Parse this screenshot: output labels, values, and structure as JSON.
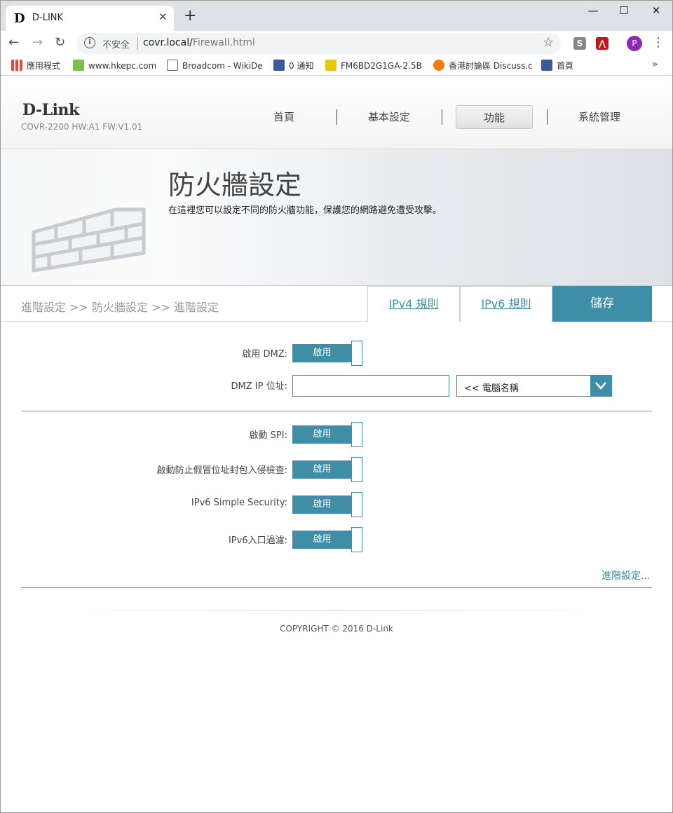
{
  "browser": {
    "tab_title": "D-LINK",
    "tab_favicon": "D",
    "not_secure": "不安全",
    "url_host": "covr.local/",
    "url_path": "Firewall.html",
    "profile_initial": "P",
    "bookmarks": [
      {
        "label": "應用程式",
        "icon": "apps-grid-icon",
        "color": "#e8453c"
      },
      {
        "label": "www.hkepc.com",
        "icon": "hkepc-icon",
        "color": "#7ac143"
      },
      {
        "label": "Broadcom - WikiDe",
        "icon": "page-icon",
        "color": "#ffffff"
      },
      {
        "label": "0 通知",
        "icon": "facebook-icon",
        "color": "#3b5998"
      },
      {
        "label": "FM6BD2G1GA-2.5B",
        "icon": "yellow-logo-icon",
        "color": "#e8c600"
      },
      {
        "label": "香港討論區 Discuss.c",
        "icon": "chat-bubble-icon",
        "color": "#f57c00"
      },
      {
        "label": "首頁",
        "icon": "facebook-icon",
        "color": "#3b5998"
      }
    ]
  },
  "header": {
    "logo": "D-Link",
    "model": "COVR-2200 HW:A1 FW:V1.01",
    "nav": [
      {
        "label": "首頁",
        "active": false
      },
      {
        "label": "基本設定",
        "active": false
      },
      {
        "label": "功能",
        "active": true
      },
      {
        "label": "系統管理",
        "active": false
      }
    ]
  },
  "hero": {
    "title": "防火牆設定",
    "description": "在這裡您可以設定不同的防火牆功能，保護您的網路避免遭受攻擊。",
    "icon": "brick-wall-icon"
  },
  "subbar": {
    "breadcrumb": "進階設定 >> 防火牆設定 >> 進階設定",
    "tab_ipv4": "IPv4 規則",
    "tab_ipv6": "IPv6 規則",
    "save": "儲存"
  },
  "form": {
    "dmz_label": "啟用 DMZ:",
    "dmz_state": "啟用",
    "dmz_ip_label": "DMZ IP 位址:",
    "dmz_ip_value": "",
    "computer_select": "<< 電腦名稱",
    "spi_label": "啟動 SPI:",
    "spi_state": "啟用",
    "antispoof_label": "啟動防止假冒位址封包入侵檢查:",
    "antispoof_state": "啟用",
    "ipv6sec_label": "IPv6 Simple Security:",
    "ipv6sec_state": "啟用",
    "ipv6filter_label": "IPv6入口過濾:",
    "ipv6filter_state": "啟用",
    "advanced_link": "進階設定..."
  },
  "footer": {
    "copyright": "COPYRIGHT © 2016 D-Link"
  },
  "colors": {
    "accent": "#3d8ea6",
    "tab_link": "#3e8fa8"
  }
}
